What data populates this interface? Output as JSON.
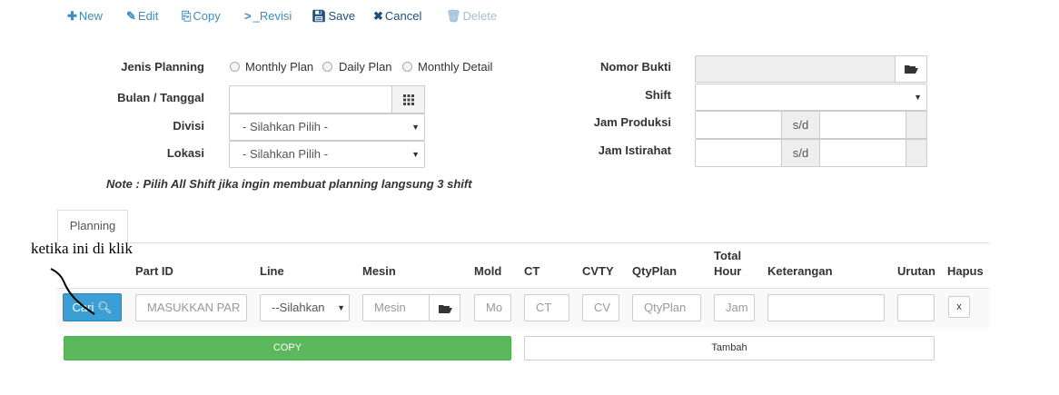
{
  "toolbar": {
    "new": "New",
    "edit": "Edit",
    "copy": "Copy",
    "revisi": "_Revisi",
    "save": "Save",
    "cancel": "Cancel",
    "delete": "Delete"
  },
  "form": {
    "jenis_planning_label": "Jenis Planning",
    "radio_options": [
      "Monthly Plan",
      "Daily Plan",
      "Monthly Detail"
    ],
    "bulan_tanggal_label": "Bulan / Tanggal",
    "bulan_tanggal_value": "",
    "divisi_label": "Divisi",
    "divisi_value": "- Silahkan Pilih -",
    "lokasi_label": "Lokasi",
    "lokasi_value": "- Silahkan Pilih -",
    "nomor_bukti_label": "Nomor Bukti",
    "nomor_bukti_value": "",
    "shift_label": "Shift",
    "shift_value": "",
    "jam_produksi_label": "Jam Produksi",
    "jam_istirahat_label": "Jam Istirahat",
    "sd": "s/d",
    "note": "Note : Pilih All Shift jika ingin membuat planning langsung 3 shift"
  },
  "tab": {
    "planning": "Planning"
  },
  "table": {
    "headers": {
      "part_id": "Part ID",
      "line": "Line",
      "mesin": "Mesin",
      "mold": "Mold",
      "ct": "CT",
      "cvty": "CVTY",
      "qtyplan": "QtyPlan",
      "total_hour_1": "Total",
      "total_hour_2": "Hour",
      "keterangan": "Keterangan",
      "urutan": "Urutan",
      "hapus": "Hapus"
    },
    "row": {
      "cari": "Cari",
      "part_placeholder": "MASUKKAN PAR",
      "line_value": "--Silahkan",
      "mesin_placeholder": "Mesin",
      "mold_placeholder": "Mo",
      "ct_placeholder": "CT",
      "cvty_placeholder": "CV",
      "qtyplan_placeholder": "QtyPlan",
      "jam_placeholder": "Jam",
      "hapus": "x"
    }
  },
  "actions": {
    "copy": "COPY",
    "tambah": "Tambah"
  },
  "annotation": "ketika ini di klik"
}
